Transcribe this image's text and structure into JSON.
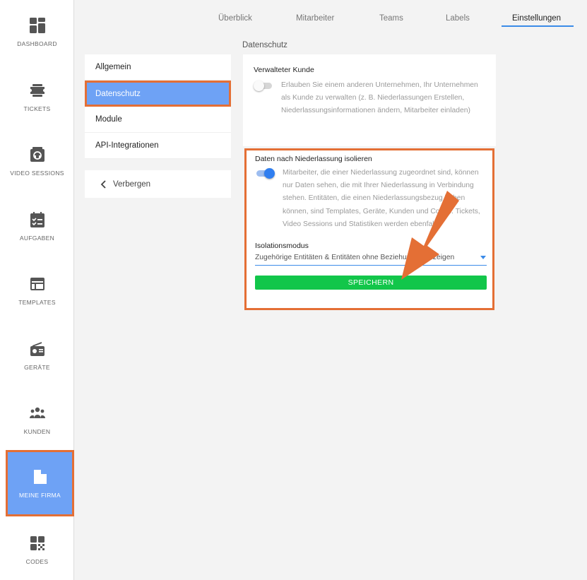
{
  "nav": {
    "items": [
      {
        "label": "DASHBOARD",
        "icon": "dashboard-icon"
      },
      {
        "label": "TICKETS",
        "icon": "tickets-icon"
      },
      {
        "label": "VIDEO SESSIONS",
        "icon": "video-sessions-icon"
      },
      {
        "label": "AUFGABEN",
        "icon": "tasks-icon"
      },
      {
        "label": "TEMPLATES",
        "icon": "templates-icon"
      },
      {
        "label": "GERÄTE",
        "icon": "devices-icon"
      },
      {
        "label": "KUNDEN",
        "icon": "customers-icon"
      },
      {
        "label": "MEINE FIRMA",
        "icon": "company-icon",
        "active": true
      },
      {
        "label": "CODES",
        "icon": "codes-icon"
      }
    ]
  },
  "tabs": [
    {
      "label": "Überblick"
    },
    {
      "label": "Mitarbeiter"
    },
    {
      "label": "Teams"
    },
    {
      "label": "Labels"
    },
    {
      "label": "Einstellungen",
      "active": true
    }
  ],
  "submenu": {
    "items": [
      {
        "label": "Allgemein"
      },
      {
        "label": "Datenschutz",
        "active": true
      },
      {
        "label": "Module"
      },
      {
        "label": "API-Integrationen"
      }
    ],
    "hide_label": "Verbergen"
  },
  "main": {
    "section_title": "Datenschutz",
    "managed_customer": {
      "title": "Verwalteter Kunde",
      "enabled": false,
      "description": "Erlauben Sie einem anderen Unternehmen, Ihr Unternehmen als Kunde zu verwalten (z. B. Niederlassungen Erstellen, Niederlassungsinformationen ändern, Mitarbeiter einladen)"
    },
    "isolate": {
      "title": "Daten nach Niederlassung isolieren",
      "enabled": true,
      "description": "Mitarbeiter, die einer Niederlassung zugeordnet sind, können nur Daten sehen, die mit Ihrer Niederlassung in Verbindung stehen. Entitäten, die einen Niederlassungsbezug haben können, sind Templates, Geräte, Kunden und Codes. Tickets, Video Sessions und Statistiken werden ebenfalls",
      "mode_label": "Isolationsmodus",
      "mode_value": "Zugehörige Entitäten & Entitäten ohne Beziehungen anzeigen",
      "save_label": "SPEICHERN"
    }
  },
  "colors": {
    "accent_blue": "#6ea2f5",
    "highlight_orange": "#e46f35",
    "save_green": "#12c64a",
    "toggle_on": "#2f7ef0"
  }
}
